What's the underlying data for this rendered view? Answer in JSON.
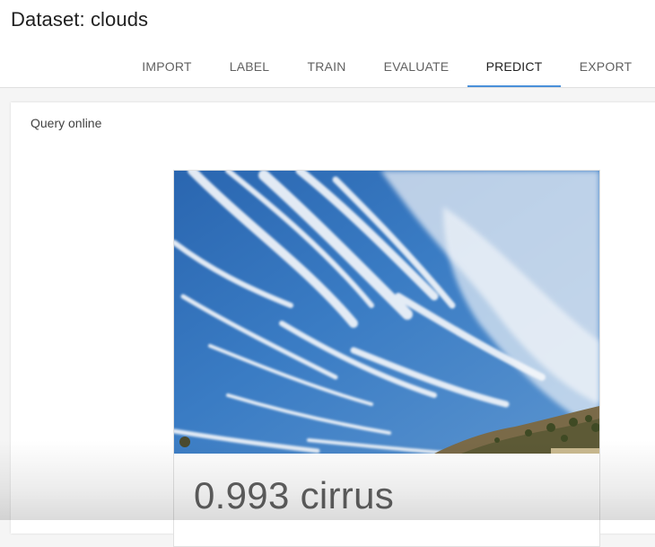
{
  "header": {
    "title": "Dataset: clouds"
  },
  "tabs": [
    {
      "label": "IMPORT",
      "active": false
    },
    {
      "label": "LABEL",
      "active": false
    },
    {
      "label": "TRAIN",
      "active": false
    },
    {
      "label": "EVALUATE",
      "active": false
    },
    {
      "label": "PREDICT",
      "active": true
    },
    {
      "label": "EXPORT",
      "active": false
    }
  ],
  "main": {
    "section_title": "Query online",
    "result": {
      "image_subject": "cirrus clouds over blue sky with hillside",
      "prediction": "0.993 cirrus"
    }
  },
  "colors": {
    "accent": "#4a90d9",
    "sky": "#2f6fb3"
  }
}
